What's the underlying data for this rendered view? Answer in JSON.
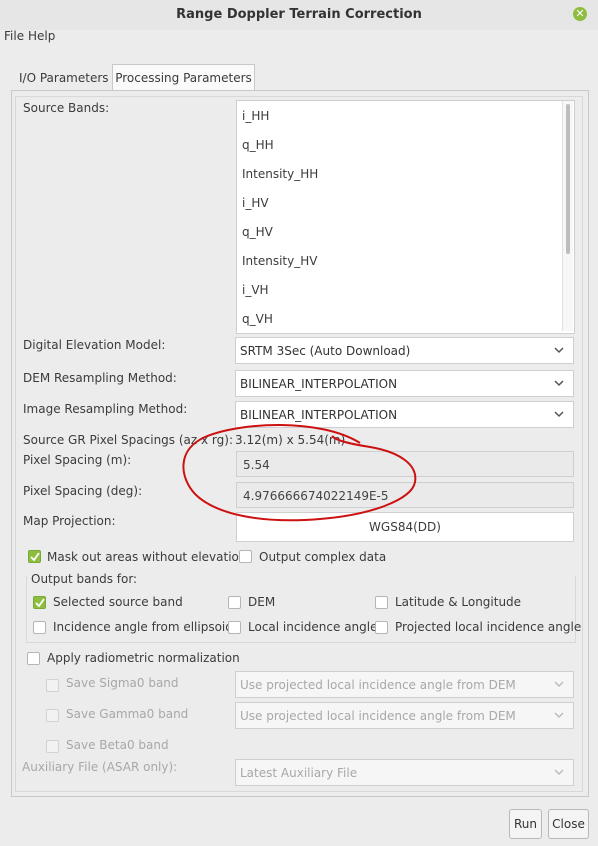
{
  "window": {
    "title": "Range Doppler Terrain Correction"
  },
  "menu": {
    "file": "File",
    "help": "Help"
  },
  "tabs": {
    "io": "I/O Parameters",
    "processing": "Processing Parameters"
  },
  "source_bands": {
    "label": "Source Bands:",
    "items": [
      "i_HH",
      "q_HH",
      "Intensity_HH",
      "i_HV",
      "q_HV",
      "Intensity_HV",
      "i_VH",
      "q_VH"
    ]
  },
  "dem": {
    "label": "Digital Elevation Model:",
    "value": "SRTM 3Sec (Auto Download)"
  },
  "dem_resampling": {
    "label": "DEM Resampling Method:",
    "value": "BILINEAR_INTERPOLATION"
  },
  "image_resampling": {
    "label": "Image Resampling Method:",
    "value": "BILINEAR_INTERPOLATION"
  },
  "gr_spacings": {
    "label": "Source GR Pixel Spacings (az x rg):",
    "value": "3.12(m) x 5.54(m)"
  },
  "pixel_spacing_m": {
    "label": "Pixel Spacing (m):",
    "value": "5.54"
  },
  "pixel_spacing_deg": {
    "label": "Pixel Spacing (deg):",
    "value": "4.976666674022149E-5"
  },
  "map_projection": {
    "label": "Map Projection:",
    "value": "WGS84(DD)"
  },
  "mask": {
    "label": "Mask out areas without elevation",
    "checked": true
  },
  "complex": {
    "label": "Output complex data",
    "checked": false
  },
  "output_bands": {
    "label": "Output bands for:",
    "selected_source_band": "Selected source band",
    "dem": "DEM",
    "lat_lon": "Latitude & Longitude",
    "incidence_ellipsoid": "Incidence angle from ellipsoid",
    "local_incidence": "Local incidence angle",
    "projected_local_incidence": "Projected local incidence angle"
  },
  "radiometric": {
    "label": "Apply radiometric normalization",
    "sigma0": "Save Sigma0 band",
    "gamma0": "Save Gamma0 band",
    "beta0": "Save Beta0 band",
    "sigma0_option": "Use projected local incidence angle from DEM",
    "gamma0_option": "Use projected local incidence angle from DEM",
    "aux_label": "Auxiliary File (ASAR only):",
    "aux_value": "Latest Auxiliary File"
  },
  "buttons": {
    "run": "Run",
    "close": "Close"
  },
  "colors": {
    "accent": "#8ebd3f",
    "annotation": "#cc1111"
  }
}
